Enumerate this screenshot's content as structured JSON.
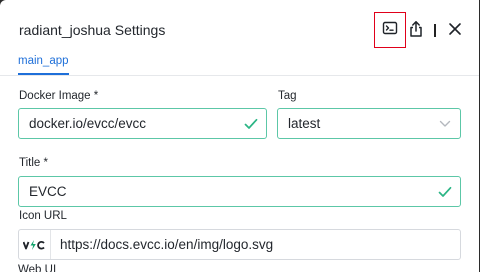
{
  "dialog": {
    "title": "radiant_joshua Settings",
    "icons": {
      "terminal": "terminal-icon",
      "share": "share-icon",
      "close": "close-icon"
    }
  },
  "tabs": [
    {
      "label": "main_app",
      "active": true
    }
  ],
  "form": {
    "docker_image": {
      "label": "Docker Image *",
      "value": "docker.io/evcc/evcc",
      "valid": true
    },
    "tag": {
      "label": "Tag",
      "value": "latest"
    },
    "title": {
      "label": "Title *",
      "value": "EVCC",
      "valid": true
    },
    "icon_url": {
      "label": "Icon URL",
      "value": "https://docs.evcc.io/en/img/logo.svg",
      "preview_text": "evcc"
    },
    "next_label": "Web UI"
  },
  "colors": {
    "accent": "#1e6fd9",
    "valid": "#2bb585",
    "highlight": "#e0001a"
  }
}
